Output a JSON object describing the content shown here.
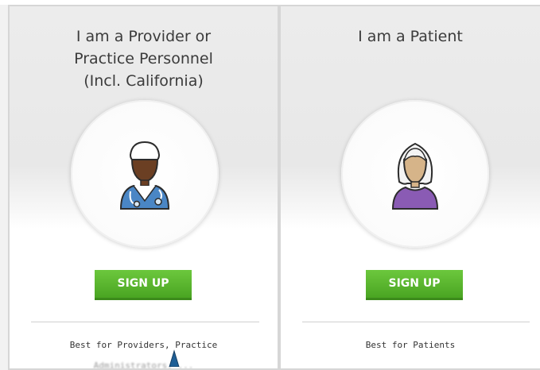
{
  "provider_card": {
    "title": "I am a Provider or\nPractice Personnel\n(Incl. California)",
    "icon": "doctor-avatar-icon",
    "signup_label": "SIGN UP",
    "best_for": "Best for Providers, Practice",
    "best_for_cont": "Administrators, ..."
  },
  "patient_card": {
    "title": "I am a Patient",
    "icon": "patient-avatar-icon",
    "signup_label": "SIGN UP",
    "best_for": "Best for Patients"
  },
  "colors": {
    "signup_green": "#5cb82f",
    "doctor_skin": "#6b3f23",
    "doctor_coat": "#4a86c5",
    "patient_skin": "#d6b489",
    "patient_shirt": "#8a5bb4"
  }
}
